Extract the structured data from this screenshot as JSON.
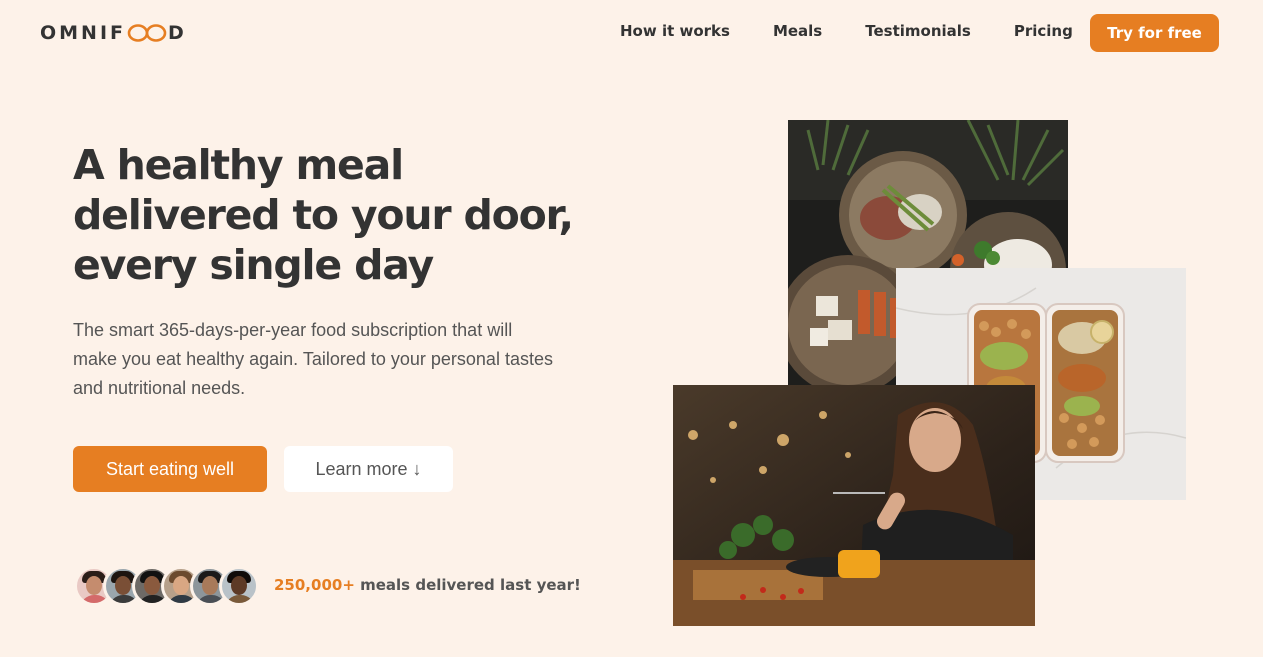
{
  "header": {
    "logo": {
      "text_before": "OMNIF",
      "text_after": "D",
      "icon": "infinity-loop-icon",
      "accent": "#e67e22"
    },
    "nav": [
      {
        "label": "How it works"
      },
      {
        "label": "Meals"
      },
      {
        "label": "Testimonials"
      },
      {
        "label": "Pricing"
      }
    ],
    "cta_label": "Try for free"
  },
  "hero": {
    "title_lines": [
      "A healthy meal",
      "delivered to your door,",
      "every single day"
    ],
    "description_lines": [
      "The smart 365-days-per-year food subscription that will",
      "make you eat healthy again. Tailored to your personal tastes",
      "and nutritional needs."
    ],
    "primary_button": "Start eating well",
    "secondary_button": "Learn more ↓",
    "delivered_count": "250,000+",
    "delivered_text": " meals delivered last year!"
  },
  "images": {
    "bowls": "bowls-of-food-photo",
    "boxes": "meal-prep-boxes-photo",
    "woman": "woman-eating-photo"
  },
  "colors": {
    "background": "#fdf2e9",
    "accent": "#e67e22",
    "text": "#333333"
  }
}
